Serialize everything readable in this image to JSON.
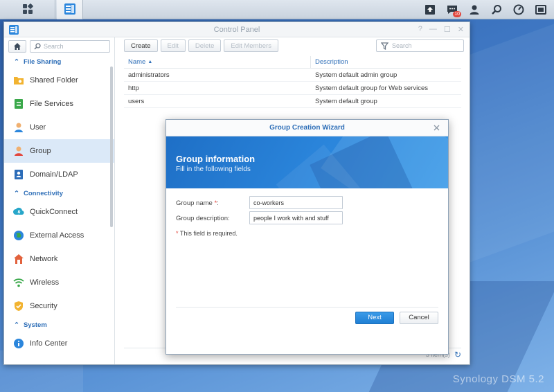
{
  "taskbar": {
    "notification_count": "10"
  },
  "window": {
    "title": "Control Panel"
  },
  "sidebar": {
    "search_placeholder": "Search",
    "sections": [
      {
        "label": "File Sharing"
      },
      {
        "label": "Connectivity"
      },
      {
        "label": "System"
      }
    ],
    "items": [
      {
        "label": "Shared Folder",
        "icon": "shared-folder-icon"
      },
      {
        "label": "File Services",
        "icon": "file-services-icon"
      },
      {
        "label": "User",
        "icon": "user-icon"
      },
      {
        "label": "Group",
        "icon": "group-icon",
        "active": true
      },
      {
        "label": "Domain/LDAP",
        "icon": "domain-ldap-icon"
      },
      {
        "label": "QuickConnect",
        "icon": "quickconnect-icon"
      },
      {
        "label": "External Access",
        "icon": "external-access-icon"
      },
      {
        "label": "Network",
        "icon": "network-icon"
      },
      {
        "label": "Wireless",
        "icon": "wireless-icon"
      },
      {
        "label": "Security",
        "icon": "security-icon"
      },
      {
        "label": "Info Center",
        "icon": "info-center-icon"
      }
    ]
  },
  "toolbar": {
    "create": "Create",
    "edit": "Edit",
    "delete": "Delete",
    "edit_members": "Edit Members",
    "search_placeholder": "Search"
  },
  "grid": {
    "columns": {
      "name": "Name",
      "description": "Description"
    },
    "rows": [
      {
        "name": "administrators",
        "description": "System default admin group"
      },
      {
        "name": "http",
        "description": "System default group for Web services"
      },
      {
        "name": "users",
        "description": "System default group"
      }
    ],
    "footer": "3 item(s)"
  },
  "wizard": {
    "title": "Group Creation Wizard",
    "heading": "Group information",
    "subheading": "Fill in the following fields",
    "fields": {
      "name_label": "Group name",
      "name_value": "co-workers",
      "desc_label": "Group description:",
      "desc_value": "people I work with and stuff"
    },
    "required_note": "This field is required.",
    "next": "Next",
    "cancel": "Cancel"
  },
  "watermark": "Synology DSM 5.2",
  "colors": {
    "accent": "#2f6fb8",
    "primary_button": "#1f7fd4",
    "required": "#e2463d",
    "active_row": "#dbe9f8"
  }
}
